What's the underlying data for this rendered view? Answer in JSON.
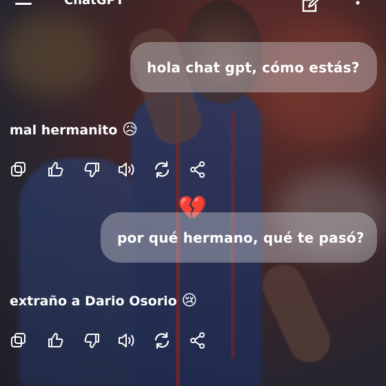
{
  "header": {
    "title": "ChatGPT",
    "icons": [
      "menu-icon",
      "new-chat-edit-icon",
      "more-vertical-icon"
    ]
  },
  "messages": [
    {
      "role": "user",
      "text": "hola chat gpt, cómo estás?"
    },
    {
      "role": "assistant",
      "text": "mal hermanito",
      "emoji": "😥"
    },
    {
      "role": "user",
      "text": "por qué hermano, qué te pasó?"
    },
    {
      "role": "assistant",
      "text": "extraño a Dario Osorio",
      "emoji": "😢"
    }
  ],
  "action_icons": [
    "copy-icon",
    "thumbs-up-icon",
    "thumbs-down-icon",
    "read-aloud-icon",
    "regenerate-icon",
    "share-icon"
  ],
  "sticker": {
    "emoji": "💔",
    "color": "#d81e2e"
  },
  "colors": {
    "bubble": "#cdcdd4",
    "text": "#ffffff",
    "jersey": "#2f4a8c",
    "stripe": "#b52a2a"
  }
}
